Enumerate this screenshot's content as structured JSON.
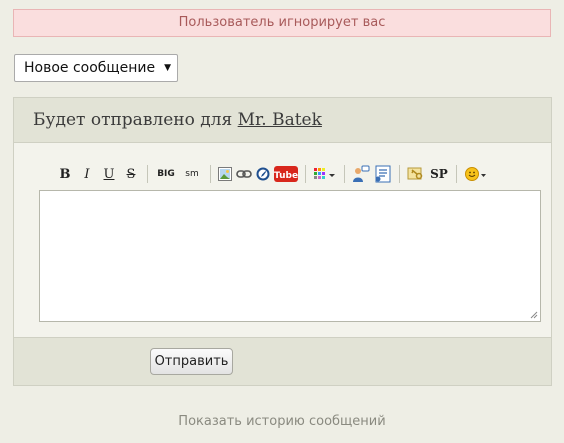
{
  "alert": {
    "text": "Пользователь игнорирует вас"
  },
  "message_type_select": {
    "selected": "Новое сообщение",
    "arrow": "▼"
  },
  "compose": {
    "header_prefix": "Будет отправлено для",
    "recipient": "Mr. Batek",
    "toolbar": {
      "bold": "B",
      "italic": "I",
      "underline": "U",
      "strike": "S",
      "big": "BIG",
      "small": "sm",
      "youtube": "Tube",
      "spoiler": "SP"
    },
    "message_value": "",
    "send_label": "Отправить"
  },
  "history_link": "Показать историю сообщений",
  "colors": {
    "alert_bg": "#fadede",
    "alert_text": "#a85a5a",
    "panel_bg": "#e2e3d6",
    "youtube_red": "#d8271c"
  }
}
